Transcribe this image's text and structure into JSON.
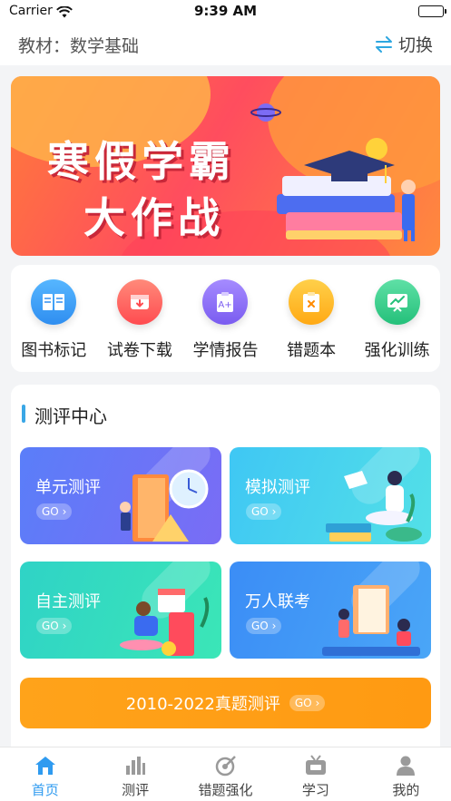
{
  "status_bar": {
    "carrier": "Carrier",
    "time": "9:39 AM"
  },
  "header": {
    "textbook_label": "教材：数学基础",
    "switch_label": "切换"
  },
  "banner": {
    "title_line1": "寒假学霸",
    "title_line2": "大作战"
  },
  "shortcuts": [
    {
      "label": "图书标记",
      "icon": "book-icon",
      "color": "#3a9ff0"
    },
    {
      "label": "试卷下载",
      "icon": "download-icon",
      "color": "#ff5a58"
    },
    {
      "label": "学情报告",
      "icon": "report-icon",
      "color": "#8b6cf4"
    },
    {
      "label": "错题本",
      "icon": "wrong-notebook-icon",
      "color": "#ffb21f"
    },
    {
      "label": "强化训练",
      "icon": "training-chart-icon",
      "color": "#35c98d"
    }
  ],
  "assessment": {
    "title": "测评中心",
    "cards": [
      {
        "name": "单元测评",
        "go": "GO"
      },
      {
        "name": "模拟测评",
        "go": "GO"
      },
      {
        "name": "自主测评",
        "go": "GO"
      },
      {
        "name": "万人联考",
        "go": "GO"
      }
    ],
    "real_exam": {
      "label": "2010-2022真题测评",
      "go": "GO"
    }
  },
  "tabbar": [
    {
      "label": "首页",
      "icon": "home-icon",
      "active": true
    },
    {
      "label": "测评",
      "icon": "bar-chart-icon",
      "active": false
    },
    {
      "label": "错题强化",
      "icon": "target-icon",
      "active": false
    },
    {
      "label": "学习",
      "icon": "tv-icon",
      "active": false
    },
    {
      "label": "我的",
      "icon": "user-icon",
      "active": false
    }
  ],
  "colors": {
    "accent": "#2f9bf0",
    "banner": "#ff5a4e",
    "real_exam": "#ffa31a"
  }
}
